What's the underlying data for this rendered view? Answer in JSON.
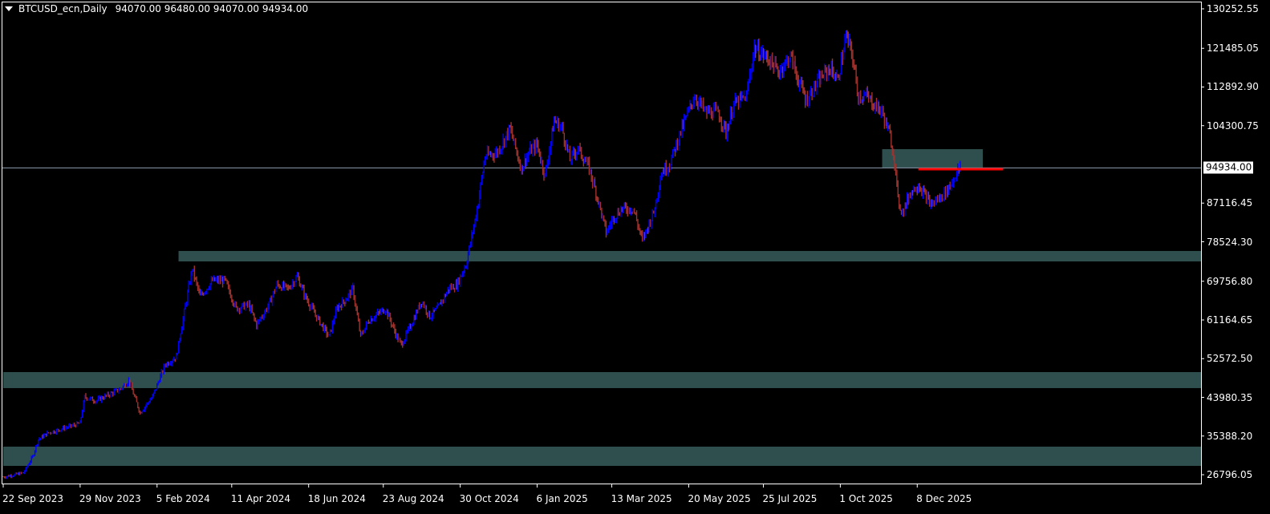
{
  "header": {
    "symbol": "BTCUSD_ecn,Daily",
    "ohlc": "94070.00 96480.00 94070.00 94934.00",
    "menu_icon": "triangle-down-icon"
  },
  "colors": {
    "background": "#000000",
    "bull_bar": "#0000ff",
    "bear_bar": "#a0322d",
    "zone": "#2f4f4f",
    "price_line": "#8c9cb0",
    "level_line": "#ff0000",
    "frame": "#ffffff"
  },
  "chart_data": {
    "type": "bar",
    "style": "ohlc-bars",
    "symbol": "BTCUSD_ecn",
    "timeframe": "Daily",
    "last": {
      "open": 94070.0,
      "high": 96480.0,
      "low": 94070.0,
      "close": 94934.0
    },
    "current_price_label": "94934.00",
    "ylim": [
      24840,
      131855
    ],
    "y_ticks": [
      "130252.55",
      "121485.05",
      "112892.90",
      "104300.75",
      "87116.45",
      "78524.30",
      "69756.80",
      "61164.65",
      "52572.50",
      "43980.35",
      "35388.20",
      "26796.05"
    ],
    "x_ticks": [
      {
        "date": "2023-09-22",
        "label": "22 Sep 2023"
      },
      {
        "date": "2023-11-29",
        "label": "29 Nov 2023"
      },
      {
        "date": "2024-02-05",
        "label": "5 Feb 2024"
      },
      {
        "date": "2024-04-11",
        "label": "11 Apr 2024"
      },
      {
        "date": "2024-06-18",
        "label": "18 Jun 2024"
      },
      {
        "date": "2024-08-23",
        "label": "23 Aug 2024"
      },
      {
        "date": "2024-10-30",
        "label": "30 Oct 2024"
      },
      {
        "date": "2025-01-06",
        "label": "6 Jan 2025"
      },
      {
        "date": "2025-03-13",
        "label": "13 Mar 2025"
      },
      {
        "date": "2025-05-20",
        "label": "20 May 2025"
      },
      {
        "date": "2025-07-25",
        "label": "25 Jul 2025"
      },
      {
        "date": "2025-10-01",
        "label": "1 Oct 2025"
      },
      {
        "date": "2025-12-08",
        "label": "8 Dec 2025"
      }
    ],
    "close_path": [
      [
        "2023-09-22",
        26300
      ],
      [
        "2023-10-10",
        27200
      ],
      [
        "2023-10-18",
        30750
      ],
      [
        "2023-10-23",
        34650
      ],
      [
        "2023-11-01",
        36100
      ],
      [
        "2023-11-29",
        38200
      ],
      [
        "2023-12-03",
        44100
      ],
      [
        "2023-12-13",
        43200
      ],
      [
        "2024-01-04",
        45900
      ],
      [
        "2024-01-11",
        47700
      ],
      [
        "2024-01-21",
        40550
      ],
      [
        "2024-02-01",
        44100
      ],
      [
        "2024-02-12",
        51200
      ],
      [
        "2024-02-22",
        53000
      ],
      [
        "2024-02-29",
        62800
      ],
      [
        "2024-03-07",
        72600
      ],
      [
        "2024-03-14",
        66350
      ],
      [
        "2024-03-25",
        69900
      ],
      [
        "2024-04-05",
        69900
      ],
      [
        "2024-04-15",
        63700
      ],
      [
        "2024-04-26",
        64550
      ],
      [
        "2024-05-03",
        60100
      ],
      [
        "2024-05-14",
        64550
      ],
      [
        "2024-05-21",
        69000
      ],
      [
        "2024-05-31",
        68100
      ],
      [
        "2024-06-08",
        70800
      ],
      [
        "2024-06-15",
        66350
      ],
      [
        "2024-06-25",
        61900
      ],
      [
        "2024-07-06",
        57450
      ],
      [
        "2024-07-13",
        63700
      ],
      [
        "2024-07-20",
        65450
      ],
      [
        "2024-07-27",
        68100
      ],
      [
        "2024-08-03",
        57450
      ],
      [
        "2024-08-10",
        61000
      ],
      [
        "2024-08-25",
        63700
      ],
      [
        "2024-09-04",
        57450
      ],
      [
        "2024-09-08",
        55650
      ],
      [
        "2024-09-15",
        59250
      ],
      [
        "2024-09-26",
        65450
      ],
      [
        "2024-10-03",
        61900
      ],
      [
        "2024-10-10",
        63700
      ],
      [
        "2024-10-20",
        68100
      ],
      [
        "2024-10-27",
        69000
      ],
      [
        "2024-11-04",
        73450
      ],
      [
        "2024-11-07",
        77000
      ],
      [
        "2024-11-14",
        85900
      ],
      [
        "2024-11-21",
        97500
      ],
      [
        "2024-12-02",
        98400
      ],
      [
        "2024-12-13",
        103700
      ],
      [
        "2024-12-23",
        94800
      ],
      [
        "2024-12-30",
        98400
      ],
      [
        "2025-01-06",
        100150
      ],
      [
        "2025-01-13",
        93050
      ],
      [
        "2025-01-21",
        105500
      ],
      [
        "2025-01-28",
        103700
      ],
      [
        "2025-02-04",
        96600
      ],
      [
        "2025-02-11",
        99300
      ],
      [
        "2025-02-21",
        94800
      ],
      [
        "2025-03-01",
        87700
      ],
      [
        "2025-03-08",
        80600
      ],
      [
        "2025-03-15",
        84150
      ],
      [
        "2025-03-22",
        85900
      ],
      [
        "2025-04-01",
        85900
      ],
      [
        "2025-04-09",
        78800
      ],
      [
        "2025-04-19",
        85050
      ],
      [
        "2025-04-26",
        93950
      ],
      [
        "2025-05-03",
        95700
      ],
      [
        "2025-05-14",
        103700
      ],
      [
        "2025-05-25",
        110850
      ],
      [
        "2025-06-04",
        107300
      ],
      [
        "2025-06-15",
        107300
      ],
      [
        "2025-06-22",
        102850
      ],
      [
        "2025-06-29",
        109050
      ],
      [
        "2025-07-10",
        110850
      ],
      [
        "2025-07-17",
        121550
      ],
      [
        "2025-07-31",
        118850
      ],
      [
        "2025-08-07",
        116200
      ],
      [
        "2025-08-18",
        119750
      ],
      [
        "2025-08-25",
        114400
      ],
      [
        "2025-09-01",
        109950
      ],
      [
        "2025-09-08",
        112650
      ],
      [
        "2025-09-15",
        115300
      ],
      [
        "2025-09-22",
        117100
      ],
      [
        "2025-09-29",
        114400
      ],
      [
        "2025-10-06",
        124200
      ],
      [
        "2025-10-11",
        120650
      ],
      [
        "2025-10-17",
        110850
      ],
      [
        "2025-10-24",
        110850
      ],
      [
        "2025-10-31",
        109050
      ],
      [
        "2025-11-07",
        107300
      ],
      [
        "2025-11-14",
        101950
      ],
      [
        "2025-11-18",
        96600
      ],
      [
        "2025-11-21",
        87700
      ],
      [
        "2025-11-25",
        85050
      ],
      [
        "2025-12-02",
        89500
      ],
      [
        "2025-12-09",
        91250
      ],
      [
        "2025-12-20",
        86800
      ],
      [
        "2025-12-30",
        88600
      ],
      [
        "2026-01-07",
        91250
      ],
      [
        "2026-01-10",
        93050
      ],
      [
        "2026-01-15",
        94934
      ]
    ],
    "zones": [
      {
        "from_date": "2024-02-24",
        "to": "right-edge",
        "low": 74160,
        "high": 76480
      },
      {
        "from_date": "2023-09-22",
        "to": "right-edge",
        "low": 46030,
        "high": 49590
      },
      {
        "from_date": "2023-09-22",
        "to": "right-edge",
        "low": 28760,
        "high": 33030
      },
      {
        "from_date": "2025-11-07",
        "to_date": "2026-02-04",
        "low": 95000,
        "high": 99090
      }
    ],
    "level_line": {
      "from_date": "2025-12-09",
      "to_date": "2026-02-22",
      "price": 94640
    },
    "grid": false
  }
}
